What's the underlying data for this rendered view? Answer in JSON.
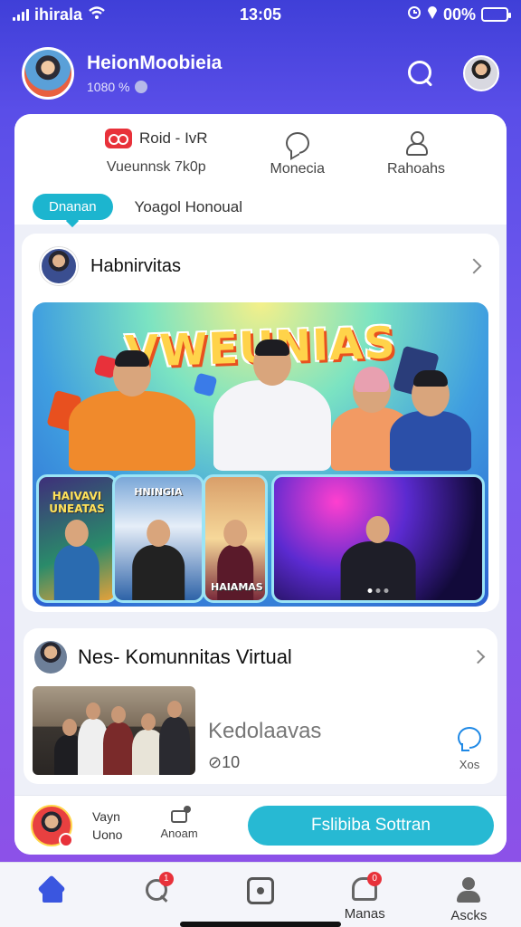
{
  "status_bar": {
    "carrier": "ihirala",
    "time": "13:05",
    "battery_text": "00%",
    "battery_level": 0.3
  },
  "header": {
    "name": "HeionMoobieia",
    "subtitle": "1080 %",
    "search_icon": "search-icon"
  },
  "top_card": {
    "stat1_title": "Roid - IvR",
    "stat1_sub": "Vueunnsk 7k0p",
    "stat2_label": "Monecia",
    "stat3_label": "Rahoahs",
    "tab_active": "Dnanan",
    "tab_other": "Yoagol Honoual"
  },
  "feed_card": {
    "title": "Habnirvitas",
    "banner_title": "VWEUNIAS",
    "tile1_caption": "HAIVAVI UNEATAS",
    "tile2_caption": "HNINGIA",
    "tile3_caption": "HAIAMAS"
  },
  "community_card": {
    "title": "Nes- Komunnitas Virtual",
    "name": "Kedolaavas",
    "count": "⊘10",
    "chat_label": "Xos"
  },
  "action_bar": {
    "user_line1": "Vayn",
    "user_line2": "Uono",
    "arrow_label": "Anoam",
    "cta_label": "Fslibiba Sottran"
  },
  "bottom_nav": {
    "items": [
      {
        "label": "",
        "icon": "home-icon",
        "active": true
      },
      {
        "label": "",
        "icon": "search-icon",
        "badge": "1"
      },
      {
        "label": "",
        "icon": "camera-icon"
      },
      {
        "label": "Manas",
        "icon": "bell-icon",
        "badge": "0"
      },
      {
        "label": "Ascks",
        "icon": "person-icon"
      }
    ]
  },
  "colors": {
    "accent": "#27b9d3",
    "brand_red": "#e8313a",
    "nav_active": "#3a56e0",
    "background_top": "#3f3fd8",
    "background_bottom": "#8f4fe6"
  }
}
